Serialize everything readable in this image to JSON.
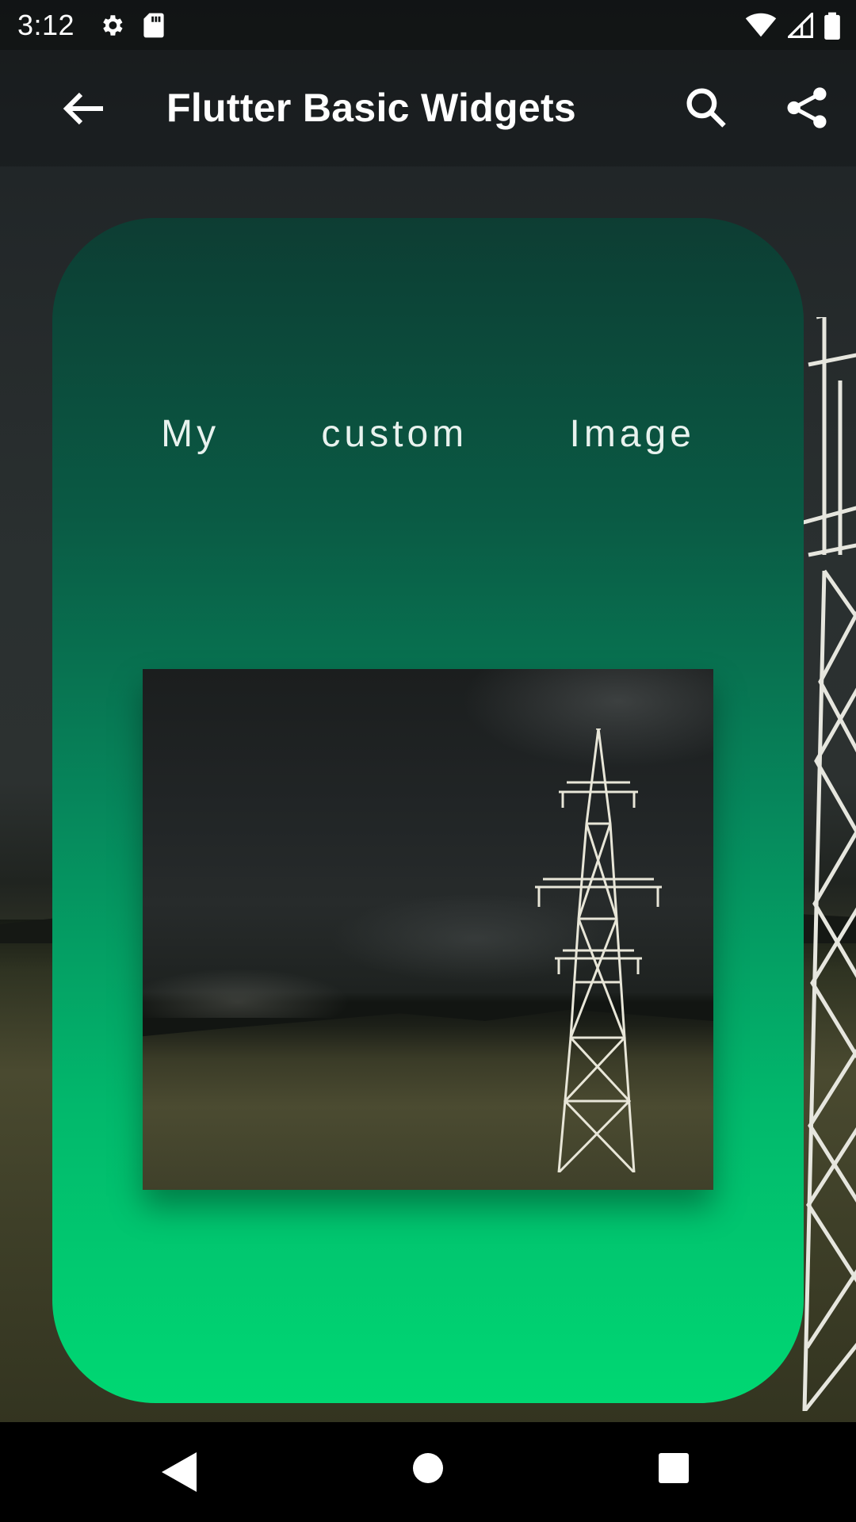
{
  "status_bar": {
    "time": "3:12",
    "icons_left": [
      "settings-icon",
      "sd-card-icon"
    ],
    "icons_right": [
      "wifi-icon",
      "signal-icon",
      "battery-icon"
    ]
  },
  "app_bar": {
    "title": "Flutter Basic Widgets",
    "leading_icon": "arrow-back-icon",
    "actions": [
      "search-icon",
      "share-icon"
    ]
  },
  "card": {
    "title": "My custom Image",
    "gradient_colors": [
      "#0d3d33",
      "#00d873"
    ],
    "image_subject": "power-pylon-photo"
  },
  "nav_bar": {
    "buttons": [
      "nav-back-icon",
      "nav-home-icon",
      "nav-recents-icon"
    ]
  }
}
